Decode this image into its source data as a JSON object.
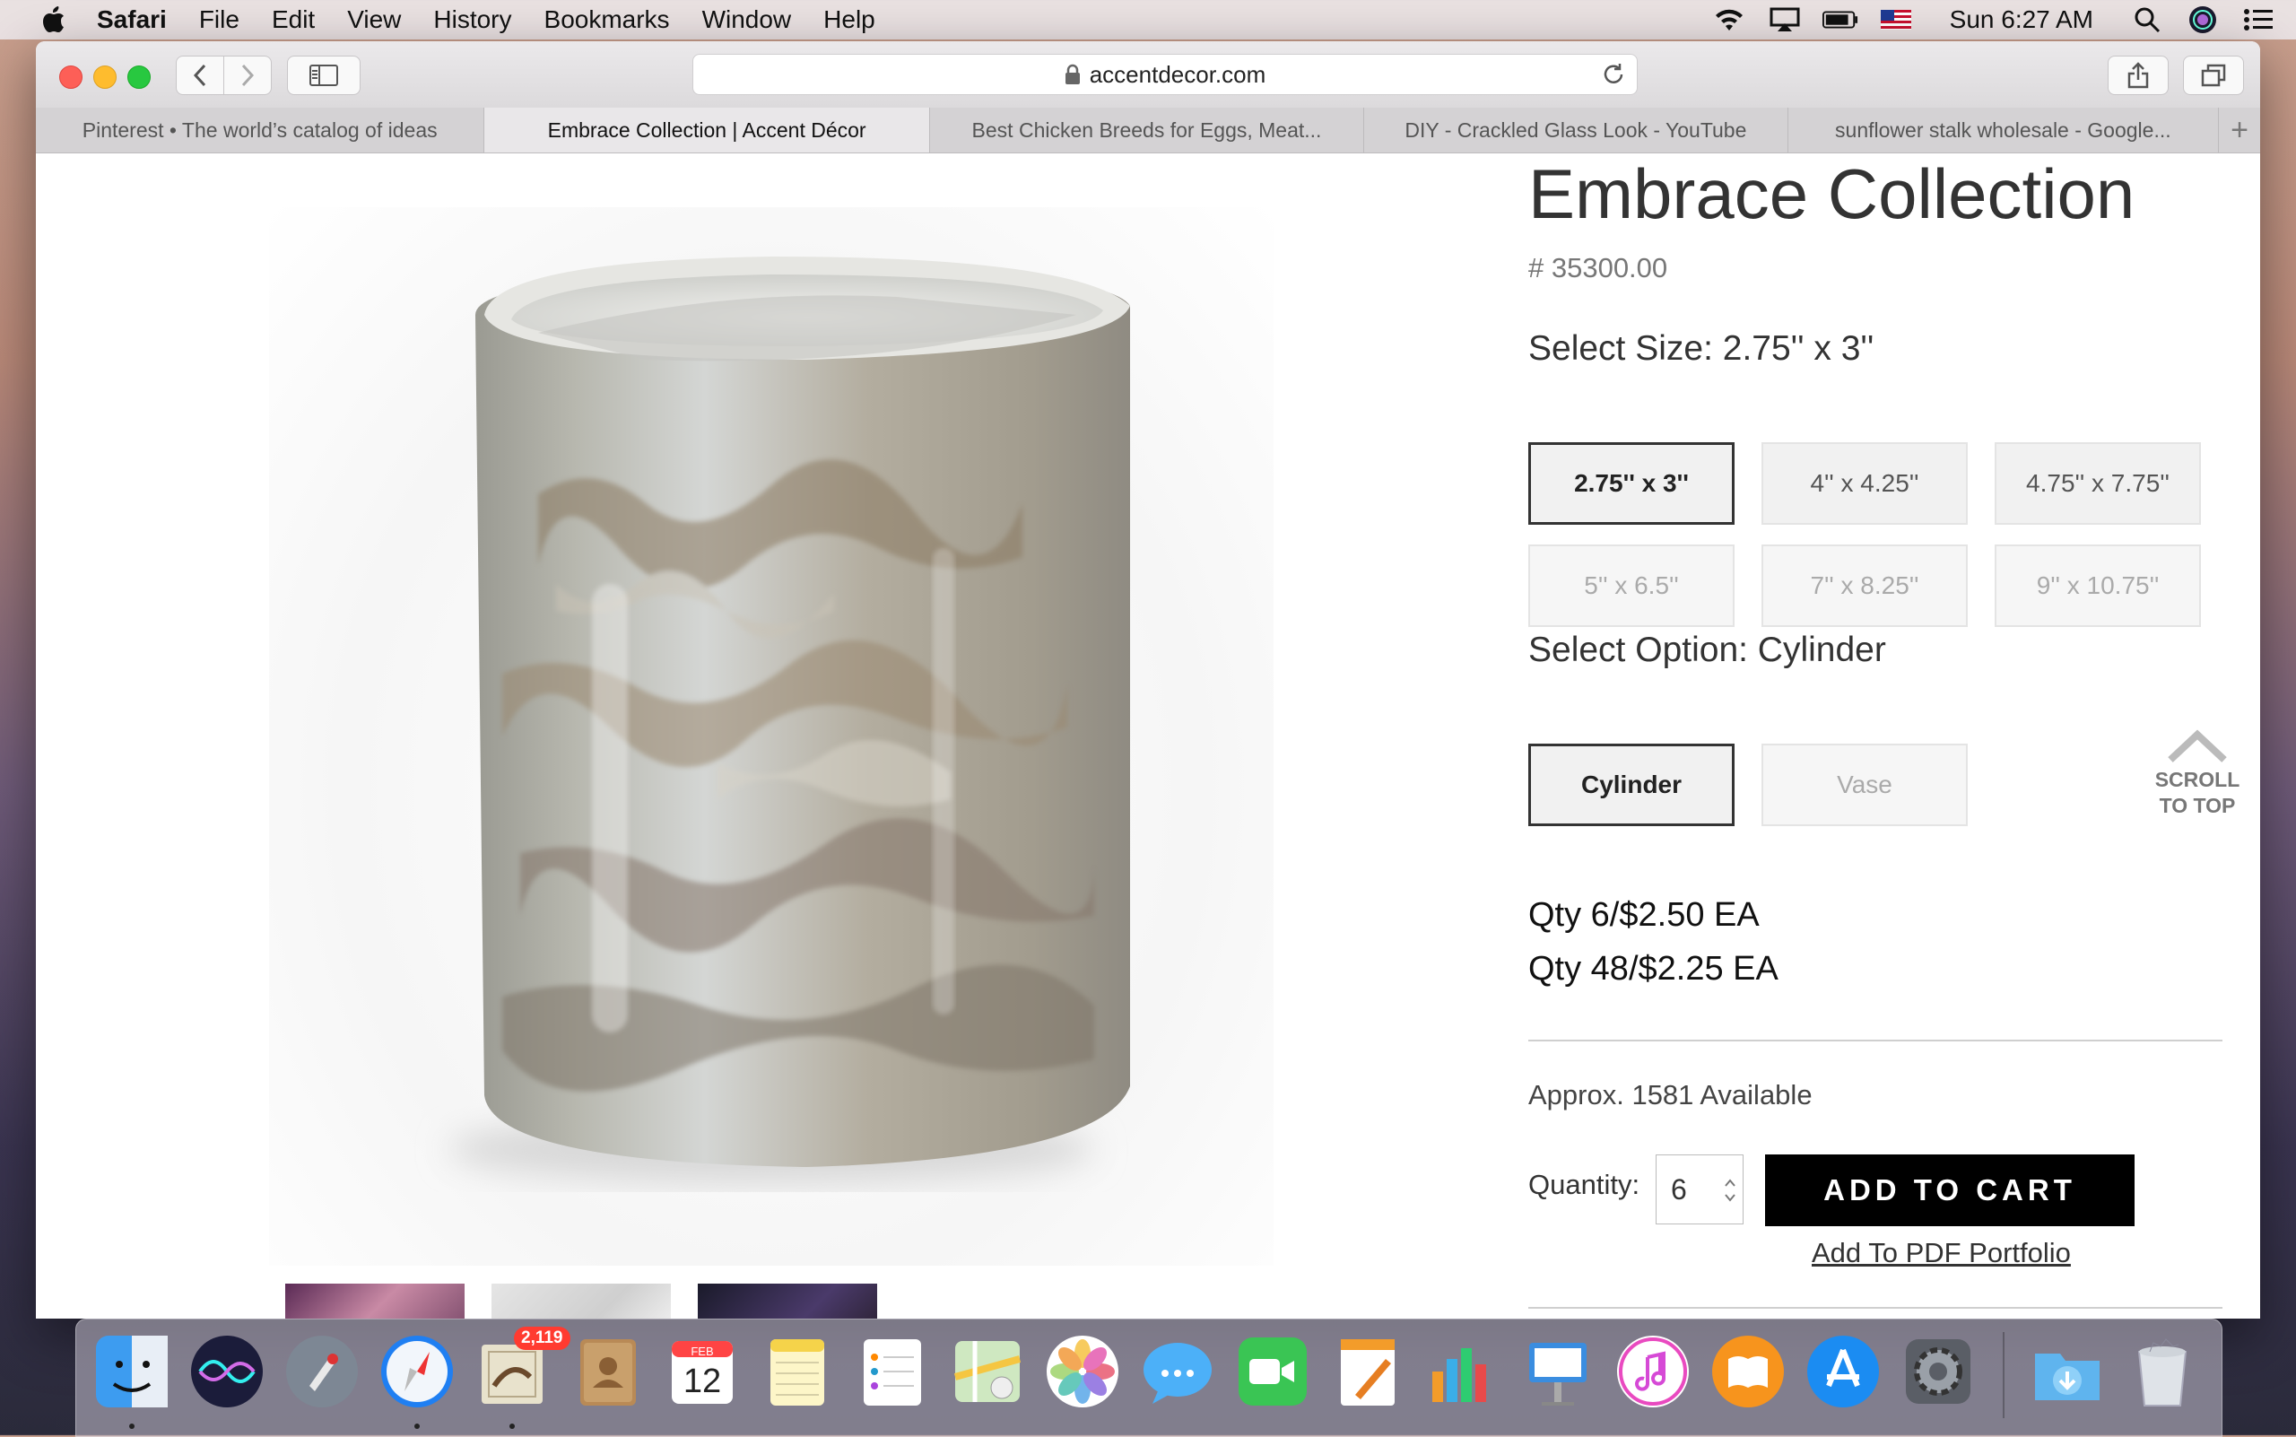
{
  "menubar": {
    "app_name": "Safari",
    "items": [
      "File",
      "Edit",
      "View",
      "History",
      "Bookmarks",
      "Window",
      "Help"
    ],
    "clock": "Sun 6:27 AM"
  },
  "browser": {
    "url": "accentdecor.com",
    "tabs": [
      "Pinterest • The world’s catalog of ideas",
      "Embrace Collection | Accent Décor",
      "Best Chicken Breeds for Eggs, Meat...",
      "DIY - Crackled Glass Look - YouTube",
      "sunflower stalk wholesale - Google..."
    ],
    "active_tab": 1,
    "new_tab": "+"
  },
  "product": {
    "title": "Embrace Collection",
    "sku": "# 35300.00",
    "size_label": "Select Size: 2.75'' x 3''",
    "sizes": [
      "2.75'' x 3''",
      "4'' x 4.25''",
      "4.75'' x 7.75''",
      "5'' x 6.5''",
      "7'' x 8.25''",
      "9'' x 10.75''"
    ],
    "selected_size": "2.75'' x 3''",
    "option_label": "Select Option: Cylinder",
    "options": [
      "Cylinder",
      "Vase"
    ],
    "selected_option": "Cylinder",
    "price_1": "Qty 6/$2.50 EA",
    "price_2": "Qty 48/$2.25 EA",
    "availability": "Approx. 1581 Available",
    "quantity_label": "Quantity:",
    "quantity_value": "6",
    "add_to_cart": "ADD TO CART",
    "add_pdf": "Add To PDF Portfolio"
  },
  "scroll_top": {
    "line1": "SCROLL",
    "line2": "TO TOP"
  },
  "dock": {
    "mail_badge": "2,119",
    "calendar_month": "FEB",
    "calendar_day": "12"
  }
}
